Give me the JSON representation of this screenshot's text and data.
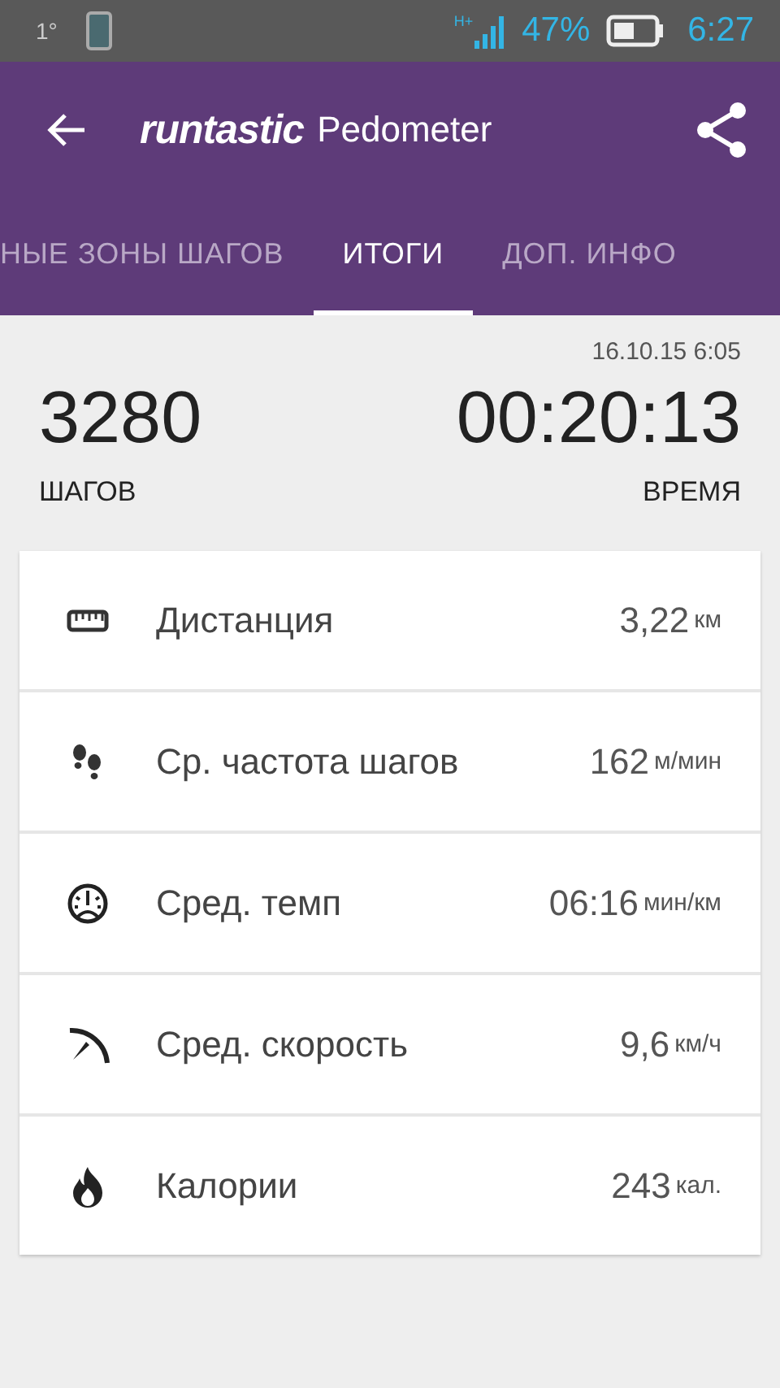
{
  "status_bar": {
    "notification": "1°",
    "network": "H+",
    "battery": "47%",
    "time": "6:27"
  },
  "app_bar": {
    "logo": "runtastic",
    "title": "Pedometer"
  },
  "tabs": [
    {
      "label": "НЫЕ ЗОНЫ ШАГОВ",
      "selected": false
    },
    {
      "label": "ИТОГИ",
      "selected": true
    },
    {
      "label": "ДОП. ИНФО",
      "selected": false
    }
  ],
  "date": "16.10.15 6:05",
  "summary": [
    {
      "value": "3280",
      "label": "ШАГОВ"
    },
    {
      "value": "00:20:13",
      "label": "ВРЕМЯ"
    }
  ],
  "stats": [
    {
      "kind": "distance",
      "label": "Дистанция",
      "value": "3,22",
      "unit": "км"
    },
    {
      "kind": "cadence",
      "label": "Ср. частота шагов",
      "value": "162",
      "unit": "м/мин"
    },
    {
      "kind": "pace",
      "label": "Сред. темп",
      "value": "06:16",
      "unit": "мин/км"
    },
    {
      "kind": "speed",
      "label": "Сред. скорость",
      "value": "9,6",
      "unit": "км/ч"
    },
    {
      "kind": "calories",
      "label": "Калории",
      "value": "243",
      "unit": "кал."
    }
  ]
}
